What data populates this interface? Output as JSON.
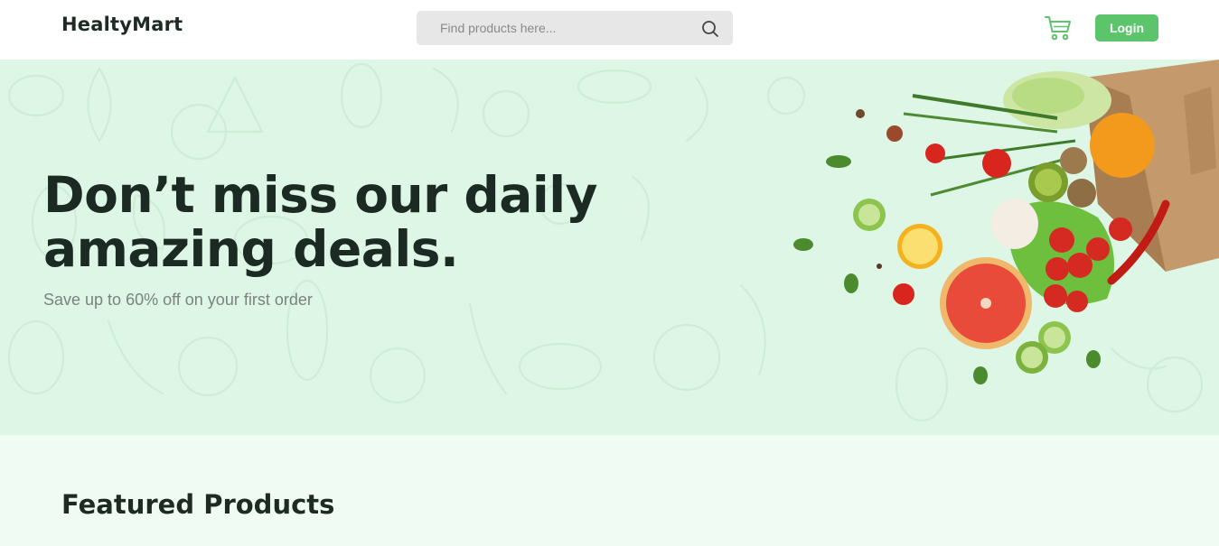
{
  "header": {
    "logo": "HealtyMart",
    "search": {
      "placeholder": "Find products here..."
    },
    "login_label": "Login",
    "icons": {
      "search": "search-icon",
      "cart": "cart-icon"
    }
  },
  "hero": {
    "title": "Don’t miss our daily amazing deals.",
    "subtitle": "Save up to 60% off on your first order",
    "image": "grocery-bag-with-vegetables"
  },
  "featured": {
    "title": "Featured Products"
  },
  "colors": {
    "accent": "#5cc46a",
    "hero_bg": "#ddf6e5",
    "featured_bg": "#f0fbf3",
    "text_dark": "#1b2a22",
    "text_muted": "#7b837e",
    "search_bg": "#e7e7e7"
  }
}
